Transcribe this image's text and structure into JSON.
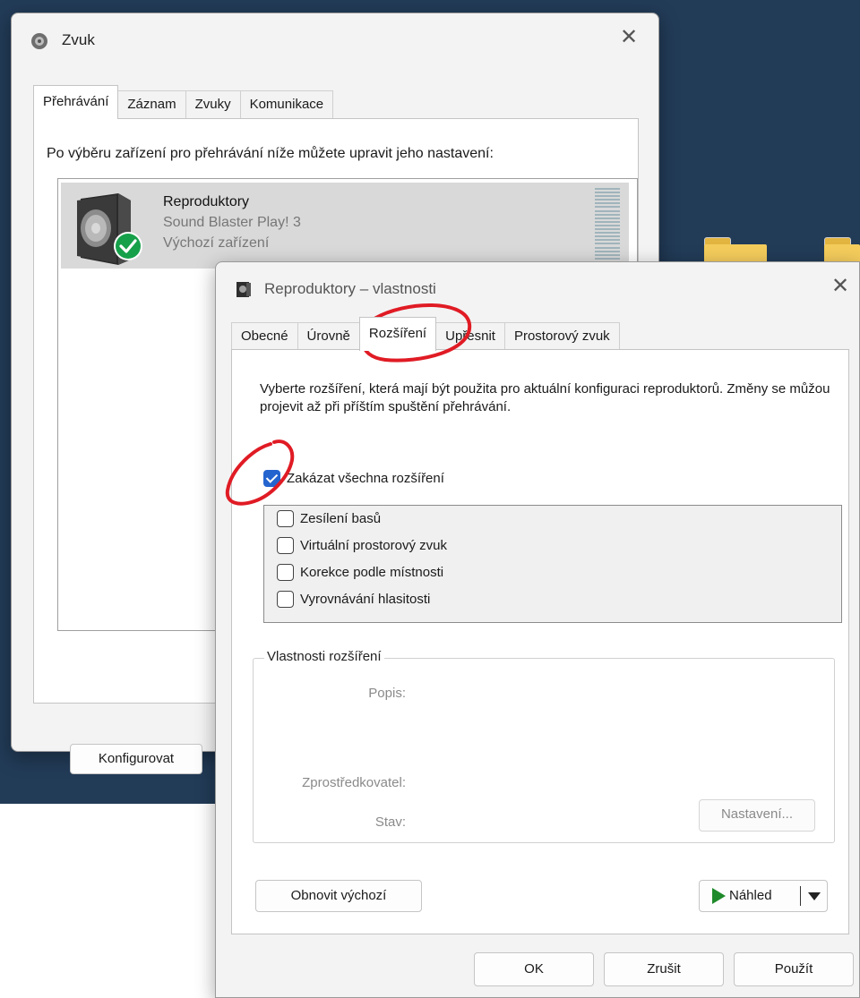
{
  "sound_window": {
    "title": "Zvuk",
    "close_glyph": "✕",
    "tabs": [
      "Přehrávání",
      "Záznam",
      "Zvuky",
      "Komunikace"
    ],
    "active_tab": 0,
    "instruction": "Po výběru zařízení pro přehrávání níže můžete upravit jeho nastavení:",
    "device": {
      "name": "Reproduktory",
      "model": "Sound Blaster Play! 3",
      "status": "Výchozí zařízení",
      "icon": "speaker-icon",
      "badge_icon": "default-checkmark-icon"
    },
    "configure_button": "Konfigurovat"
  },
  "properties_window": {
    "title": "Reproduktory – vlastnosti",
    "close_glyph": "✕",
    "tabs": [
      "Obecné",
      "Úrovně",
      "Rozšíření",
      "Upřesnit",
      "Prostorový zvuk"
    ],
    "active_tab": 2,
    "description": "Vyberte rozšíření, která mají být použita pro aktuální konfiguraci reproduktorů. Změny se můžou projevit až při příštím spuštění přehrávání.",
    "disable_all": {
      "label": "Zakázat všechna rozšíření",
      "checked": true
    },
    "enhancements": [
      {
        "label": "Zesílení basů",
        "checked": false
      },
      {
        "label": "Virtuální prostorový zvuk",
        "checked": false
      },
      {
        "label": "Korekce podle místnosti",
        "checked": false
      },
      {
        "label": "Vyrovnávání hlasitosti",
        "checked": false
      }
    ],
    "enhancement_properties": {
      "legend": "Vlastnosti rozšíření",
      "description_label": "Popis:",
      "provider_label": "Zprostředkovatel:",
      "status_label": "Stav:",
      "settings_button": "Nastavení..."
    },
    "restore_button": "Obnovit výchozí",
    "preview_button": "Náhled",
    "ok_button": "OK",
    "cancel_button": "Zrušit",
    "apply_button": "Použít"
  },
  "colors": {
    "desktop": "#223b57",
    "checkbox_accent": "#2464cf",
    "annotation_red": "#e01b24",
    "preview_play": "#1f8a2b"
  }
}
